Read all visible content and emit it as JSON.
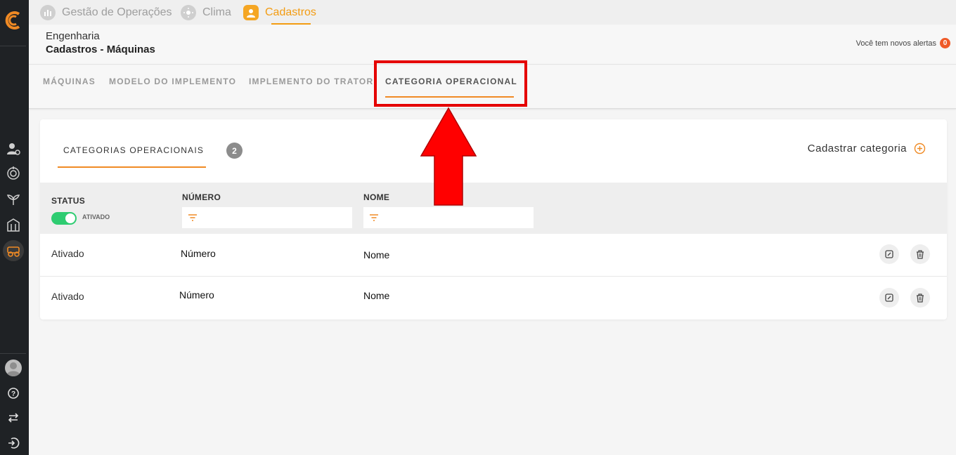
{
  "top_tabs": [
    {
      "label": "Gestão de Operações",
      "icon": "chart-icon"
    },
    {
      "label": "Clima",
      "icon": "sun-icon"
    },
    {
      "label": "Cadastros",
      "icon": "user-icon",
      "active": true
    }
  ],
  "header": {
    "breadcrumb_parent": "Engenharia",
    "breadcrumb_current": "Cadastros - Máquinas",
    "alerts_label": "Você tem novos alertas",
    "alerts_count": "0"
  },
  "sub_tabs": [
    {
      "label": "MÁQUINAS"
    },
    {
      "label": "MODELO DO IMPLEMENTO"
    },
    {
      "label": "IMPLEMENTO DO TRATOR"
    },
    {
      "label": "CATEGORIA OPERACIONAL",
      "active": true
    }
  ],
  "card": {
    "tab_label": "CATEGORIAS OPERACIONAIS",
    "count": "2",
    "add_label": "Cadastrar categoria"
  },
  "filters": {
    "status_label": "STATUS",
    "toggle_label": "ATIVADO",
    "numero_label": "NÚMERO",
    "nome_label": "NOME"
  },
  "rows": [
    {
      "status": "Ativado",
      "numero": "Número",
      "nome": "Nome"
    },
    {
      "status": "Ativado",
      "numero": "Número",
      "nome": "Nome"
    }
  ],
  "colors": {
    "accent": "#f08a24",
    "highlight": "#e50000",
    "toggle_on": "#2ecc71",
    "sidebar_bg": "#1f2225"
  }
}
